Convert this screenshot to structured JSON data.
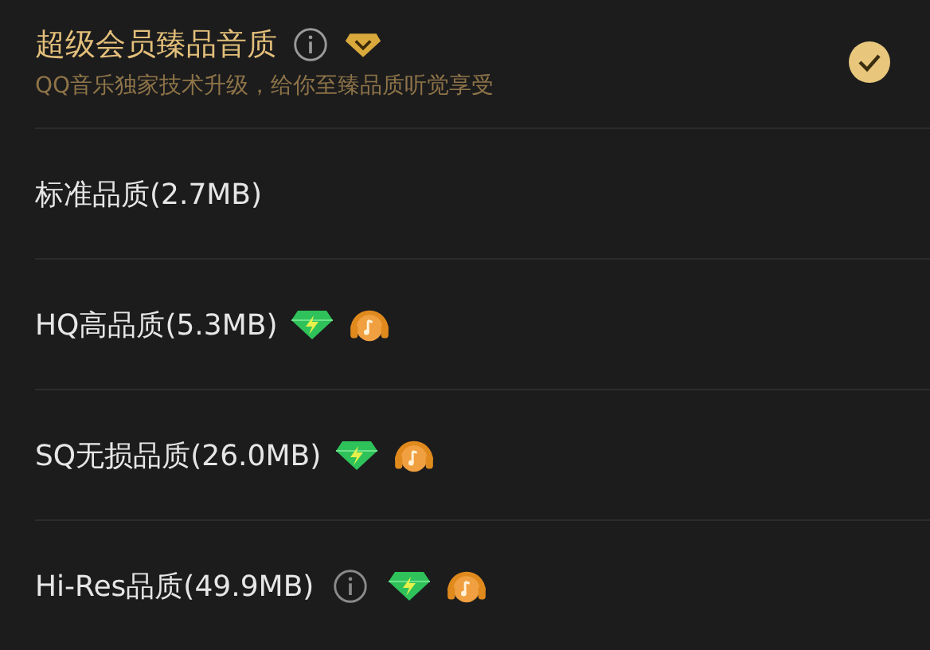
{
  "premium": {
    "title": "超级会员臻品音质",
    "subtitle": "QQ音乐独家技术升级，给你至臻品质听觉享受",
    "selected": true
  },
  "options": [
    {
      "label": "标准品质(2.7MB)",
      "info": false,
      "badges": false
    },
    {
      "label": "HQ高品质(5.3MB)",
      "info": false,
      "badges": true
    },
    {
      "label": "SQ无损品质(26.0MB)",
      "info": false,
      "badges": true
    },
    {
      "label": "Hi-Res品质(49.9MB)",
      "info": true,
      "badges": true
    }
  ]
}
